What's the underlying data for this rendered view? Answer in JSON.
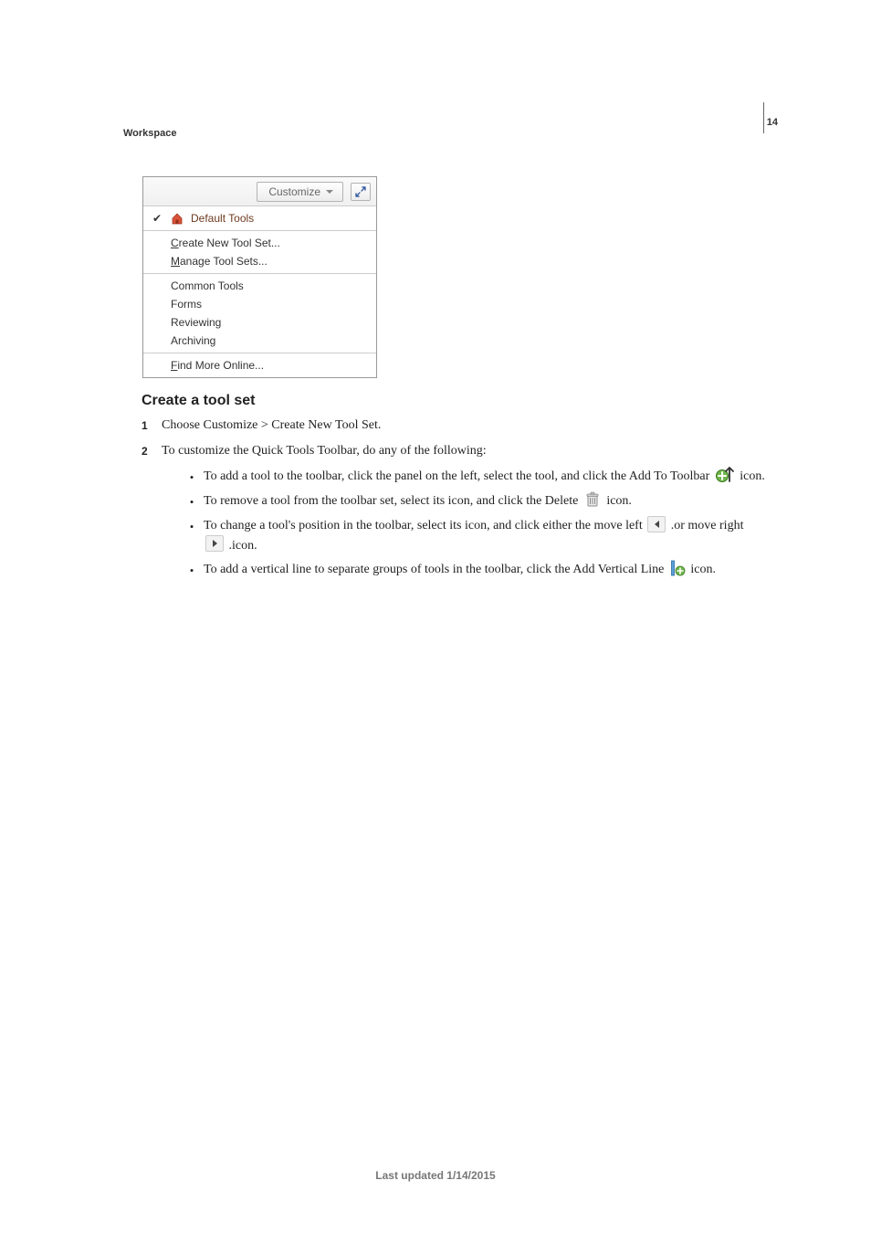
{
  "header": {
    "section_title": "Workspace",
    "page_number": "14"
  },
  "menu": {
    "customize_label": "Customize",
    "items_checked": "Default Tools",
    "group2": [
      "Create New Tool Set...",
      "Manage Tool Sets..."
    ],
    "group3": [
      "Common Tools",
      "Forms",
      "Reviewing",
      "Archiving"
    ],
    "group4": "Find More Online..."
  },
  "article": {
    "heading": "Create a tool set",
    "step1": "Choose Customize > Create New Tool Set.",
    "step2_intro": "To customize the Quick Tools Toolbar, do any of the following:",
    "bullets": {
      "b1_a": "To add a tool to the toolbar, click the panel on the left, select the tool, and click the Add To Toolbar ",
      "b1_b": " icon.",
      "b2_a": "To remove a tool from the toolbar set, select its icon, and click the Delete ",
      "b2_b": " icon.",
      "b3_a": "To change a tool's position in the toolbar, select its icon, and click either the move left ",
      "b3_mid": " .or move right ",
      "b3_b": " .icon.",
      "b4_a": "To add a vertical line to separate groups of tools in the toolbar, click the Add Vertical Line ",
      "b4_b": "icon."
    }
  },
  "footer": {
    "updated": "Last updated 1/14/2015"
  }
}
